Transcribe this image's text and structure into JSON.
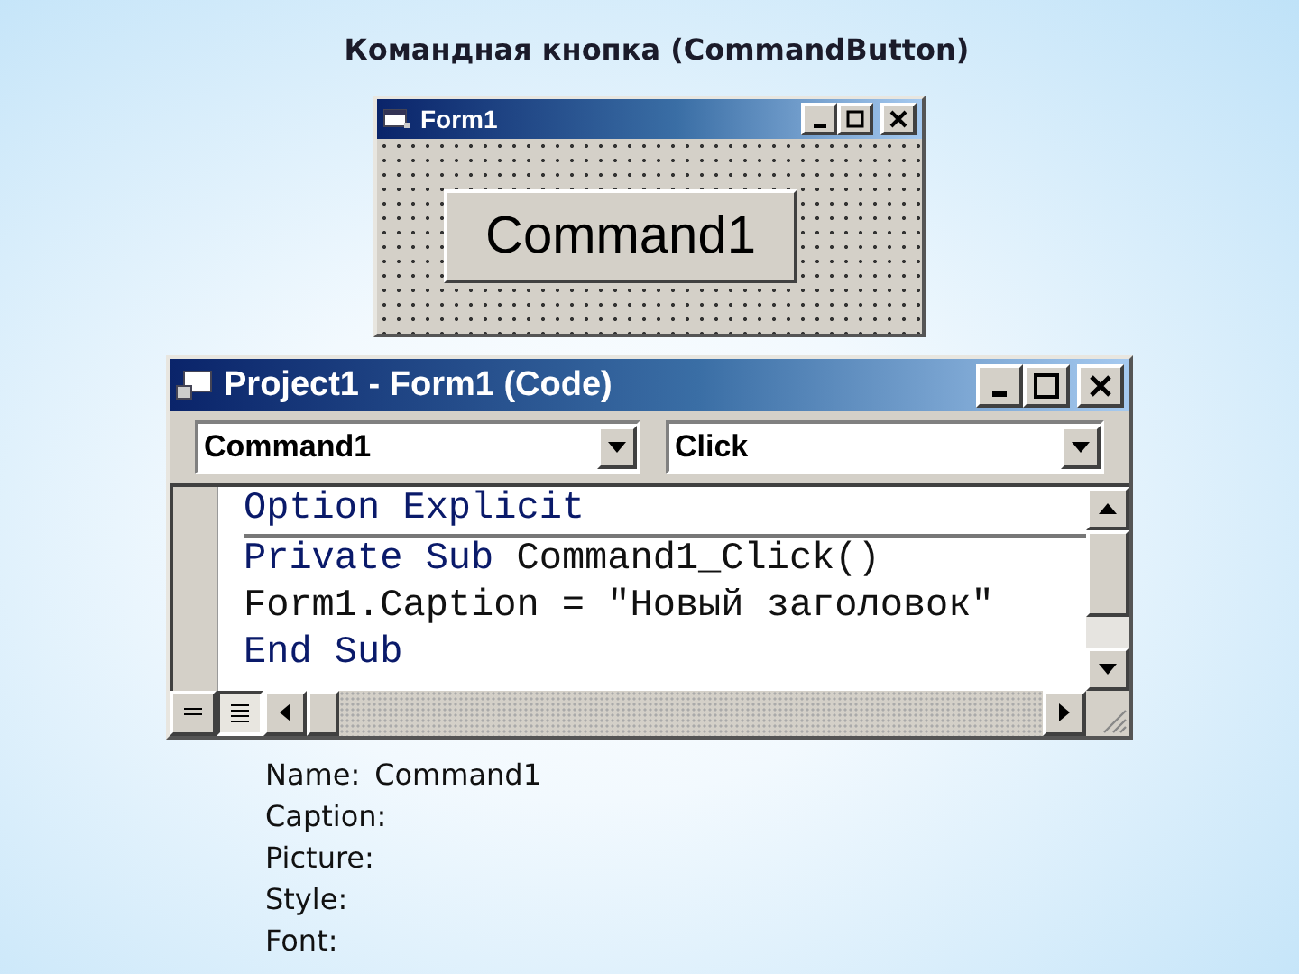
{
  "slide_title": "Командная кнопка (CommandButton)",
  "form_window": {
    "title": "Form1",
    "command_button": "Command1"
  },
  "code_window": {
    "title": "Project1 - Form1 (Code)",
    "object_combo": "Command1",
    "procedure_combo": "Click",
    "code_lines": [
      {
        "separator_below": true,
        "segments": [
          {
            "text": "Option Explicit",
            "kind": "keyword"
          }
        ]
      },
      {
        "separator_below": false,
        "segments": [
          {
            "text": "Private Sub ",
            "kind": "keyword"
          },
          {
            "text": "Command1_Click()",
            "kind": "plain"
          }
        ]
      },
      {
        "separator_below": false,
        "segments": [
          {
            "text": "Form1.Caption = \"Новый заголовок\"",
            "kind": "plain"
          }
        ]
      },
      {
        "separator_below": false,
        "segments": [
          {
            "text": "End Sub",
            "kind": "keyword"
          }
        ]
      }
    ]
  },
  "properties": [
    {
      "label": "Name:",
      "value": "Command1"
    },
    {
      "label": "Caption:"
    },
    {
      "label": "Picture:"
    },
    {
      "label": "Style:"
    },
    {
      "label": "Font:"
    }
  ]
}
